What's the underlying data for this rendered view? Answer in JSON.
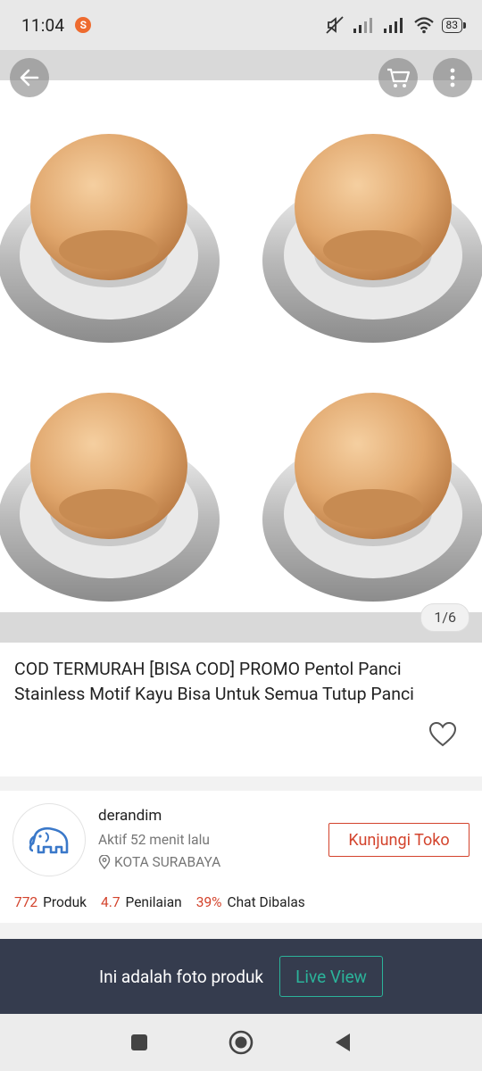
{
  "status_bar": {
    "time": "11:04",
    "app_badge": "S",
    "battery": "83"
  },
  "gallery": {
    "page_indicator": "1/6"
  },
  "product": {
    "title": "COD TERMURAH [BISA COD] PROMO Pentol Panci Stainless Motif Kayu Bisa Untuk Semua Tutup Panci"
  },
  "shop": {
    "name": "derandim",
    "active_status": "Aktif 52 menit lalu",
    "location": "KOTA SURABAYA",
    "visit_label": "Kunjungi Toko",
    "stats": [
      {
        "value": "772",
        "label": "Produk"
      },
      {
        "value": "4.7",
        "label": "Penilaian"
      },
      {
        "value": "39%",
        "label": "Chat Dibalas"
      }
    ]
  },
  "live_banner": {
    "text": "Ini adalah foto produk",
    "button_label": "Live View"
  },
  "colors": {
    "accent": "#d3432c",
    "live_green": "#2bb39a",
    "banner_bg": "#353c4e"
  },
  "icons": [
    "back-arrow-icon",
    "cart-icon",
    "more-vertical-icon",
    "heart-icon",
    "location-pin-icon",
    "nav-square-icon",
    "nav-home-icon",
    "nav-back-icon"
  ]
}
